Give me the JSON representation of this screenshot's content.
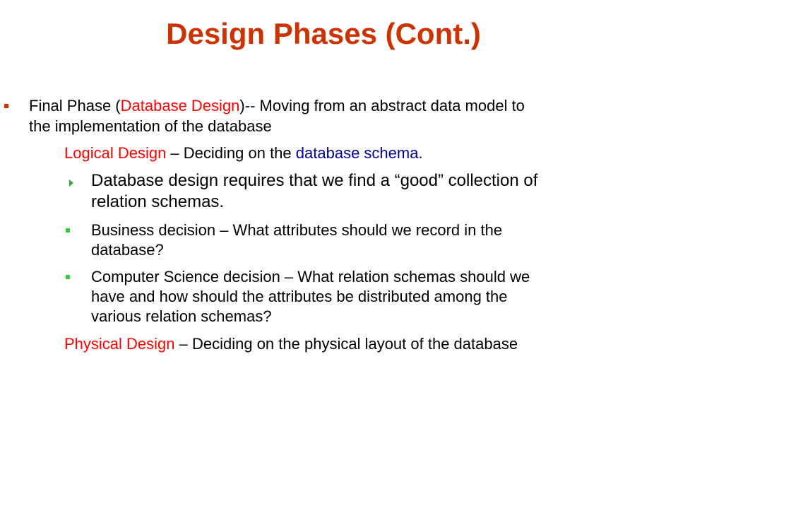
{
  "slide": {
    "title": "Design Phases (Cont.)"
  },
  "bullet1": {
    "label": "Final Phase",
    "paren_open": " (",
    "highlight": "Database Design",
    "rest": ")-- Moving from an abstract data model to",
    "line2": "the implementation of the database"
  },
  "logical": {
    "label": "Logical Design",
    "dash": " –  Deciding on the ",
    "highlight": "database schema",
    "period": "."
  },
  "sub1": {
    "line1": "Database design requires that we find a “good” collection of",
    "line2": "relation schemas."
  },
  "sub2": {
    "line1": "Business decision – What attributes should we record in the",
    "line2": "database?"
  },
  "sub3": {
    "line1": "Computer Science decision –  What relation schemas should we",
    "line2": "have and how should the attributes be distributed among the",
    "line3": "various relation schemas?"
  },
  "physical": {
    "label": "Physical Design",
    "rest": " – Deciding on the physical layout of the database"
  },
  "colors": {
    "title": "#cc3300",
    "highlight_red": "#ff0000",
    "highlight_blue": "#000099",
    "bullet_main": "#cc3300",
    "bullet_sub": "#33cc33"
  },
  "icons": {
    "main_bullet": "square-bullet-icon",
    "sub_bullet_triangle": "triangle-bullet-icon",
    "sub_bullet_square": "square-bullet-icon"
  }
}
